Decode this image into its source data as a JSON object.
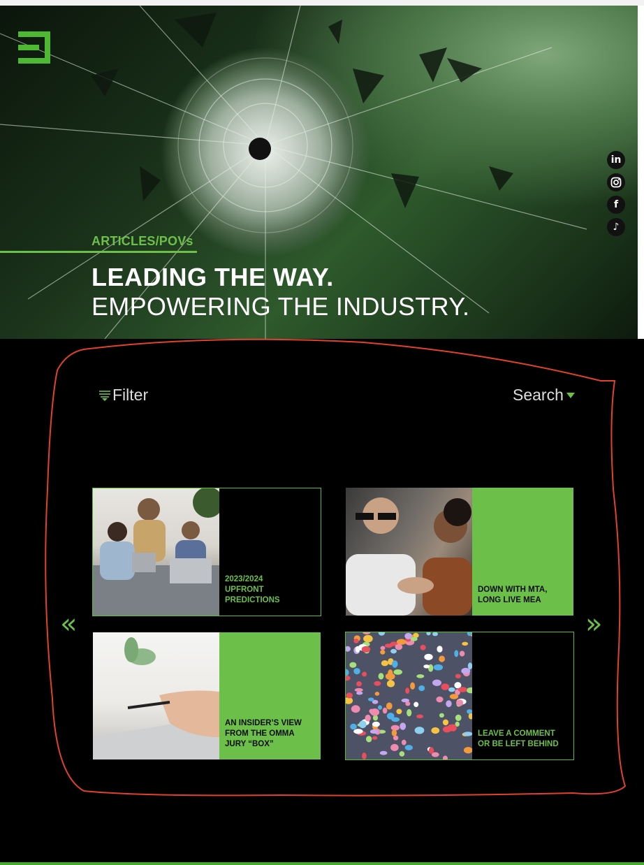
{
  "hero": {
    "category": "ARTICLES/POVs",
    "headline_line1": "LEADING THE WAY.",
    "headline_line2": "EMPOWERING THE INDUSTRY."
  },
  "social": [
    "linkedin-icon",
    "instagram-icon",
    "facebook-icon",
    "tiktok-icon"
  ],
  "social_glyphs": {
    "linkedin": "in",
    "facebook": "f",
    "tiktok": "♪"
  },
  "toolbar": {
    "filter_label": "Filter",
    "search_label": "Search"
  },
  "nav": {
    "prev_glyph": "«",
    "next_glyph": "»"
  },
  "articles": [
    {
      "title": "2023/2024 UPFRONT PREDICTIONS",
      "lines": [
        "2023/2024",
        "UPFRONT",
        "PREDICTIONS"
      ],
      "style": "dark"
    },
    {
      "title": "DOWN WITH MTA, LONG LIVE MEA",
      "lines": [
        "DOWN WITH MTA,",
        "LONG LIVE MEA"
      ],
      "style": "green"
    },
    {
      "title": "AN INSIDER’S VIEW FROM THE OMMA JURY “BOX”",
      "lines": [
        "AN INSIDER’S VIEW",
        "FROM THE OMMA",
        "JURY “BOX”"
      ],
      "style": "green"
    },
    {
      "title": "LEAVE A COMMENT OR BE LEFT BEHIND",
      "lines": [
        "LEAVE A COMMENT",
        "OR BE LEFT BEHIND"
      ],
      "style": "dark"
    }
  ],
  "colors": {
    "accent": "#6cc04a",
    "annotation": "#e0422b"
  }
}
